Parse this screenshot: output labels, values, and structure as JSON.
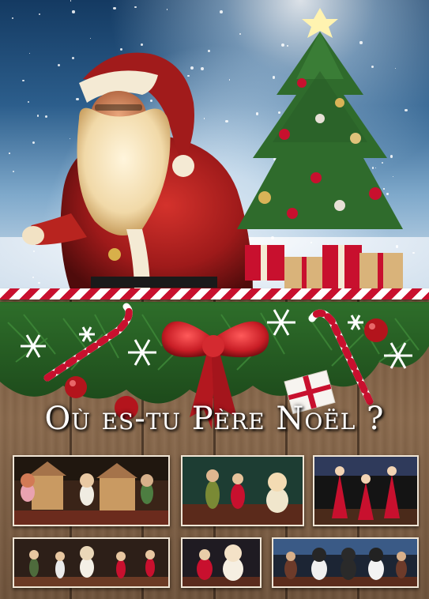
{
  "poster": {
    "title": "Où es-tu Père Noël ?"
  },
  "colors": {
    "candy_red": "#c8102e",
    "bow_red": "#c81d25",
    "wood": "#7a5a3f",
    "title_text": "#ffffff",
    "pine_green": "#2f6b2c"
  },
  "icons": [
    "santa-figure",
    "christmas-tree",
    "red-bow",
    "snowflake-icon",
    "candy-cane-icon",
    "ornament-icon",
    "gift-box-icon"
  ],
  "photos": [
    {
      "name": "stage-photo-cabins"
    },
    {
      "name": "stage-photo-elves"
    },
    {
      "name": "stage-photo-dancers-red"
    },
    {
      "name": "stage-photo-dance-line"
    },
    {
      "name": "stage-photo-teddy"
    },
    {
      "name": "stage-photo-penguins"
    }
  ]
}
